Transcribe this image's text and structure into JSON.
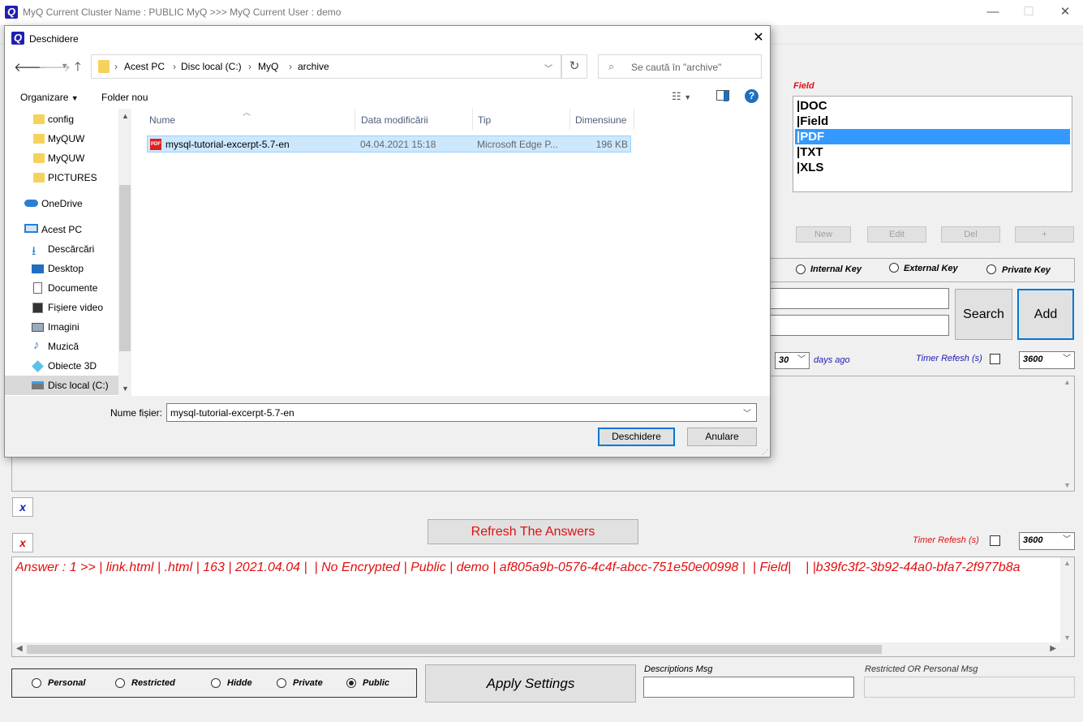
{
  "window": {
    "app_icon": "Q",
    "title": "MyQ Current Cluster Name : PUBLIC MyQ >>> MyQ Current User : demo",
    "minimize": "—",
    "maximize": "☐",
    "close": "✕"
  },
  "field_panel": {
    "label": "Field",
    "items": [
      "|DOC",
      "|Field",
      "|PDF",
      "|TXT",
      "|XLS"
    ],
    "selected": "|PDF",
    "buttons": {
      "new": "New",
      "edit": "Edit",
      "del": "Del",
      "plus": "+"
    }
  },
  "keys": {
    "internal": "Internal Key",
    "external": "External Key",
    "private": "Private Key"
  },
  "actions": {
    "search": "Search",
    "add": "Add"
  },
  "filter": {
    "days_value": "30",
    "days_label": "days ago",
    "timer_label": "Timer Refesh (s)",
    "timer_value": "3600"
  },
  "answers": {
    "clear_x1": "x",
    "clear_x2": "x",
    "refresh_button": "Refresh The Answers",
    "timer_label": "Timer Refesh (s)",
    "timer_value": "3600",
    "answer_text": "Answer : 1 >> | link.html | .html | 163 | 2021.04.04 |  | No Encrypted | Public | demo | af805a9b-0576-4c4f-abcc-751e50e00998 |  | Field|    | |b39fc3f2-3b92-44a0-bfa7-2f977b8a"
  },
  "settings": {
    "options": [
      "Personal",
      "Restricted",
      "Hidde",
      "Private",
      "Public"
    ],
    "selected": "Public",
    "apply_button": "Apply Settings",
    "descriptions_label": "Descriptions Msg",
    "restricted_label": "Restricted OR Personal Msg"
  },
  "dialog": {
    "title": "Deschidere",
    "close": "✕",
    "breadcrumb": [
      "Acest PC",
      "Disc local (C:)",
      "MyQ",
      "archive"
    ],
    "search_placeholder": "Se caută în \"archive\"",
    "toolbar": {
      "organize": "Organizare",
      "new_folder": "Folder nou"
    },
    "nav": {
      "folders": [
        "config",
        "MyQUW",
        "MyQUW",
        "PICTURES"
      ],
      "onedrive": "OneDrive",
      "this_pc": "Acest PC",
      "pc_items": [
        "Descărcări",
        "Desktop",
        "Documente",
        "Fișiere video",
        "Imagini",
        "Muzică",
        "Obiecte 3D",
        "Disc local (C:)"
      ]
    },
    "columns": [
      "Nume",
      "Data modificării",
      "Tip",
      "Dimensiune"
    ],
    "files": [
      {
        "name": "mysql-tutorial-excerpt-5.7-en",
        "date": "04.04.2021 15:18",
        "type": "Microsoft Edge P...",
        "size": "196 KB"
      }
    ],
    "filename_label": "Nume fișier:",
    "filename_value": "mysql-tutorial-excerpt-5.7-en",
    "open_button": "Deschidere",
    "cancel_button": "Anulare"
  },
  "colors": {
    "selection": "#3399ff",
    "file_selected": "#cce8ff",
    "accent_red": "#e01010",
    "accent_blue": "#1a1ab0"
  }
}
